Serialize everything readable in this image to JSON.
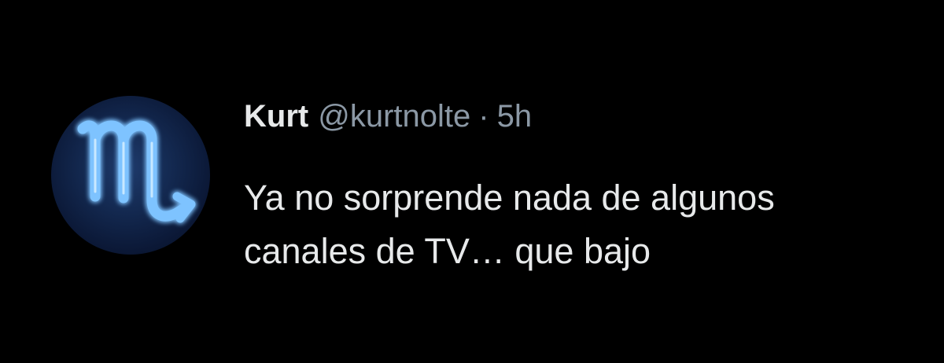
{
  "tweet": {
    "author": {
      "display_name": "Kurt",
      "handle": "@kurtnolte",
      "avatar_icon": "scorpio-zodiac-icon"
    },
    "separator": "·",
    "timestamp": "5h",
    "text_lines": [
      "Ya no sorprende nada de algunos",
      "canales de TV… que bajo"
    ]
  },
  "colors": {
    "background": "#000000",
    "primary_text": "#e7e9ea",
    "secondary_text": "#8b98a5",
    "avatar_glyph": "#7ec3ff"
  }
}
